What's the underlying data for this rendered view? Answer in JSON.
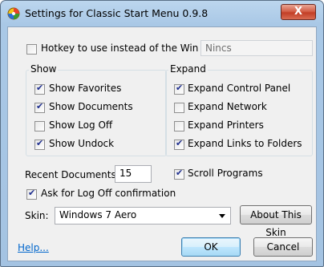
{
  "window": {
    "title": "Settings for Classic Start Menu 0.9.8",
    "close_label": "X"
  },
  "hotkey": {
    "label": "Hotkey to use instead of the Win key:",
    "checked": false,
    "value": "Nincs"
  },
  "show_group": {
    "title": "Show",
    "items": [
      {
        "label": "Show Favorites",
        "checked": true
      },
      {
        "label": "Show Documents",
        "checked": true
      },
      {
        "label": "Show Log Off",
        "checked": false
      },
      {
        "label": "Show Undock",
        "checked": true
      }
    ]
  },
  "expand_group": {
    "title": "Expand",
    "items": [
      {
        "label": "Expand Control Panel",
        "checked": true
      },
      {
        "label": "Expand Network",
        "checked": false
      },
      {
        "label": "Expand Printers",
        "checked": false
      },
      {
        "label": "Expand Links to Folders",
        "checked": true
      }
    ]
  },
  "recent_documents": {
    "label": "Recent Documents:",
    "value": "15"
  },
  "scroll_programs": {
    "label": "Scroll Programs",
    "checked": true
  },
  "logoff_confirm": {
    "label": "Ask for Log Off confirmation",
    "checked": true
  },
  "skin": {
    "label": "Skin:",
    "selected": "Windows 7 Aero",
    "about_label": "About This Skin"
  },
  "footer": {
    "help_label": "Help...",
    "ok_label": "OK",
    "cancel_label": "Cancel"
  }
}
